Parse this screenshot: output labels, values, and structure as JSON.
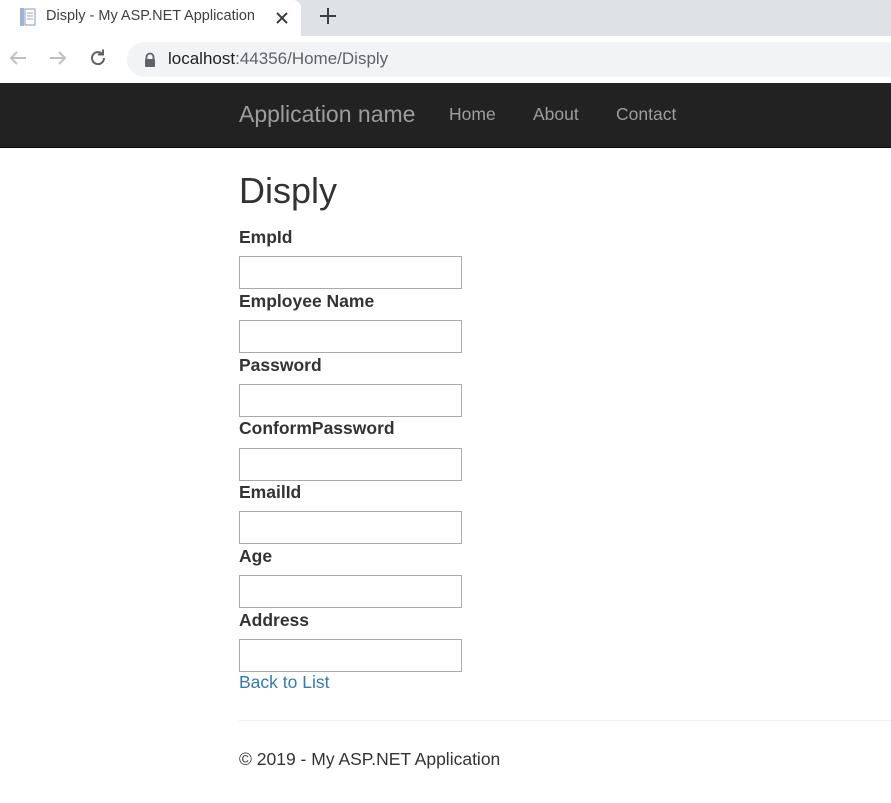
{
  "browser": {
    "tab_title": "Disply - My ASP.NET Application",
    "url_host": "localhost",
    "url_rest": ":44356/Home/Disply"
  },
  "navbar": {
    "brand": "Application name",
    "links": [
      "Home",
      "About",
      "Contact"
    ]
  },
  "page": {
    "title": "Disply",
    "fields": [
      {
        "label": "EmpId",
        "value": ""
      },
      {
        "label": "Employee Name",
        "value": ""
      },
      {
        "label": "Password",
        "value": ""
      },
      {
        "label": "ConformPassword",
        "value": ""
      },
      {
        "label": "EmailId",
        "value": ""
      },
      {
        "label": "Age",
        "value": ""
      },
      {
        "label": "Address",
        "value": ""
      }
    ],
    "back_link": "Back to List"
  },
  "footer": {
    "text": "© 2019 - My ASP.NET Application"
  }
}
